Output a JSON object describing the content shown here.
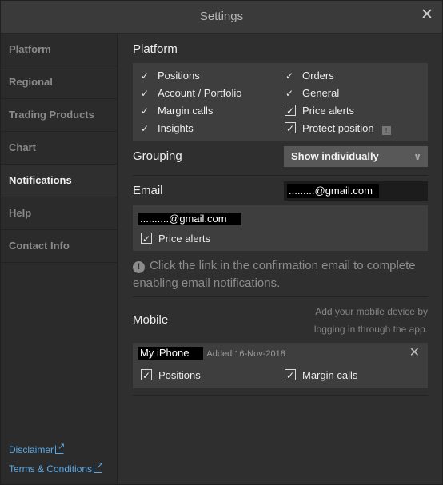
{
  "window": {
    "title": "Settings",
    "close_glyph": "✕"
  },
  "sidebar": {
    "items": [
      {
        "label": "Platform"
      },
      {
        "label": "Regional"
      },
      {
        "label": "Trading Products"
      },
      {
        "label": "Chart"
      },
      {
        "label": "Notifications",
        "active": true
      },
      {
        "label": "Help"
      },
      {
        "label": "Contact Info"
      }
    ],
    "links": {
      "disclaimer": "Disclaimer",
      "terms": "Terms & Conditions"
    }
  },
  "platform": {
    "title": "Platform",
    "left": [
      {
        "label": "Positions"
      },
      {
        "label": "Account / Portfolio"
      },
      {
        "label": "Margin calls"
      },
      {
        "label": "Insights"
      }
    ],
    "right": [
      {
        "label": "Orders"
      },
      {
        "label": "General"
      },
      {
        "label": "Price alerts",
        "checkbox": true
      },
      {
        "label": "Protect position",
        "checkbox": true
      }
    ],
    "info_glyph": "!"
  },
  "grouping": {
    "label": "Grouping",
    "value": "Show individually",
    "chevron": "∨"
  },
  "email": {
    "label": "Email",
    "input_value": ".........@gmail.com",
    "address": "..........@gmail.com",
    "price_alerts": "Price alerts",
    "note": "Click the link in the confirmation email to complete enabling email notifications.",
    "note_icon": "!"
  },
  "mobile": {
    "label": "Mobile",
    "hint": "Add your mobile device by logging in through the app.",
    "device": {
      "name": "My iPhone",
      "added": "Added 16-Nov-2018",
      "positions": "Positions",
      "margin_calls": "Margin calls",
      "remove_glyph": "✕"
    }
  },
  "colors": {
    "background": "#2f2f2f",
    "panel": "#3e3e3e",
    "link": "#5aa9e6",
    "select": "#585858"
  }
}
